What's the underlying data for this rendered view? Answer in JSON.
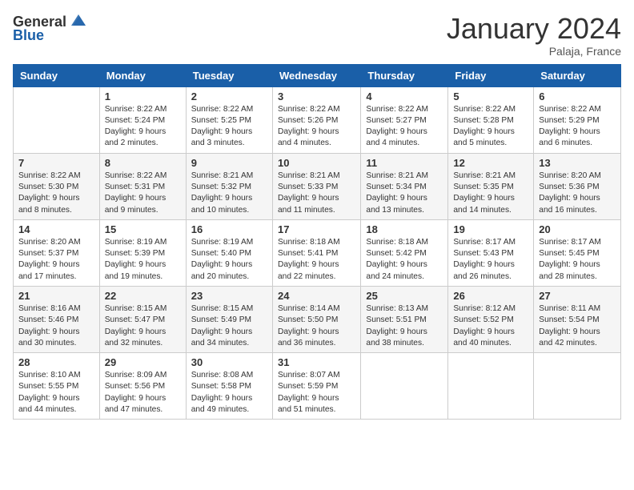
{
  "logo": {
    "general": "General",
    "blue": "Blue"
  },
  "title": "January 2024",
  "location": "Palaja, France",
  "days_of_week": [
    "Sunday",
    "Monday",
    "Tuesday",
    "Wednesday",
    "Thursday",
    "Friday",
    "Saturday"
  ],
  "weeks": [
    [
      {
        "day": "",
        "info": ""
      },
      {
        "day": "1",
        "info": "Sunrise: 8:22 AM\nSunset: 5:24 PM\nDaylight: 9 hours\nand 2 minutes."
      },
      {
        "day": "2",
        "info": "Sunrise: 8:22 AM\nSunset: 5:25 PM\nDaylight: 9 hours\nand 3 minutes."
      },
      {
        "day": "3",
        "info": "Sunrise: 8:22 AM\nSunset: 5:26 PM\nDaylight: 9 hours\nand 4 minutes."
      },
      {
        "day": "4",
        "info": "Sunrise: 8:22 AM\nSunset: 5:27 PM\nDaylight: 9 hours\nand 4 minutes."
      },
      {
        "day": "5",
        "info": "Sunrise: 8:22 AM\nSunset: 5:28 PM\nDaylight: 9 hours\nand 5 minutes."
      },
      {
        "day": "6",
        "info": "Sunrise: 8:22 AM\nSunset: 5:29 PM\nDaylight: 9 hours\nand 6 minutes."
      }
    ],
    [
      {
        "day": "7",
        "info": "Sunrise: 8:22 AM\nSunset: 5:30 PM\nDaylight: 9 hours\nand 8 minutes."
      },
      {
        "day": "8",
        "info": "Sunrise: 8:22 AM\nSunset: 5:31 PM\nDaylight: 9 hours\nand 9 minutes."
      },
      {
        "day": "9",
        "info": "Sunrise: 8:21 AM\nSunset: 5:32 PM\nDaylight: 9 hours\nand 10 minutes."
      },
      {
        "day": "10",
        "info": "Sunrise: 8:21 AM\nSunset: 5:33 PM\nDaylight: 9 hours\nand 11 minutes."
      },
      {
        "day": "11",
        "info": "Sunrise: 8:21 AM\nSunset: 5:34 PM\nDaylight: 9 hours\nand 13 minutes."
      },
      {
        "day": "12",
        "info": "Sunrise: 8:21 AM\nSunset: 5:35 PM\nDaylight: 9 hours\nand 14 minutes."
      },
      {
        "day": "13",
        "info": "Sunrise: 8:20 AM\nSunset: 5:36 PM\nDaylight: 9 hours\nand 16 minutes."
      }
    ],
    [
      {
        "day": "14",
        "info": "Sunrise: 8:20 AM\nSunset: 5:37 PM\nDaylight: 9 hours\nand 17 minutes."
      },
      {
        "day": "15",
        "info": "Sunrise: 8:19 AM\nSunset: 5:39 PM\nDaylight: 9 hours\nand 19 minutes."
      },
      {
        "day": "16",
        "info": "Sunrise: 8:19 AM\nSunset: 5:40 PM\nDaylight: 9 hours\nand 20 minutes."
      },
      {
        "day": "17",
        "info": "Sunrise: 8:18 AM\nSunset: 5:41 PM\nDaylight: 9 hours\nand 22 minutes."
      },
      {
        "day": "18",
        "info": "Sunrise: 8:18 AM\nSunset: 5:42 PM\nDaylight: 9 hours\nand 24 minutes."
      },
      {
        "day": "19",
        "info": "Sunrise: 8:17 AM\nSunset: 5:43 PM\nDaylight: 9 hours\nand 26 minutes."
      },
      {
        "day": "20",
        "info": "Sunrise: 8:17 AM\nSunset: 5:45 PM\nDaylight: 9 hours\nand 28 minutes."
      }
    ],
    [
      {
        "day": "21",
        "info": "Sunrise: 8:16 AM\nSunset: 5:46 PM\nDaylight: 9 hours\nand 30 minutes."
      },
      {
        "day": "22",
        "info": "Sunrise: 8:15 AM\nSunset: 5:47 PM\nDaylight: 9 hours\nand 32 minutes."
      },
      {
        "day": "23",
        "info": "Sunrise: 8:15 AM\nSunset: 5:49 PM\nDaylight: 9 hours\nand 34 minutes."
      },
      {
        "day": "24",
        "info": "Sunrise: 8:14 AM\nSunset: 5:50 PM\nDaylight: 9 hours\nand 36 minutes."
      },
      {
        "day": "25",
        "info": "Sunrise: 8:13 AM\nSunset: 5:51 PM\nDaylight: 9 hours\nand 38 minutes."
      },
      {
        "day": "26",
        "info": "Sunrise: 8:12 AM\nSunset: 5:52 PM\nDaylight: 9 hours\nand 40 minutes."
      },
      {
        "day": "27",
        "info": "Sunrise: 8:11 AM\nSunset: 5:54 PM\nDaylight: 9 hours\nand 42 minutes."
      }
    ],
    [
      {
        "day": "28",
        "info": "Sunrise: 8:10 AM\nSunset: 5:55 PM\nDaylight: 9 hours\nand 44 minutes."
      },
      {
        "day": "29",
        "info": "Sunrise: 8:09 AM\nSunset: 5:56 PM\nDaylight: 9 hours\nand 47 minutes."
      },
      {
        "day": "30",
        "info": "Sunrise: 8:08 AM\nSunset: 5:58 PM\nDaylight: 9 hours\nand 49 minutes."
      },
      {
        "day": "31",
        "info": "Sunrise: 8:07 AM\nSunset: 5:59 PM\nDaylight: 9 hours\nand 51 minutes."
      },
      {
        "day": "",
        "info": ""
      },
      {
        "day": "",
        "info": ""
      },
      {
        "day": "",
        "info": ""
      }
    ]
  ]
}
